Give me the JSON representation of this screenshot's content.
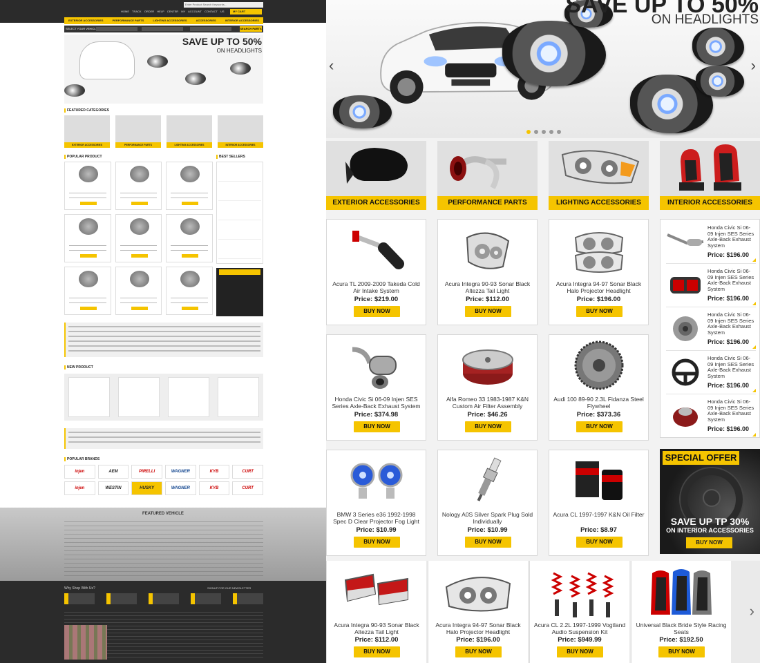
{
  "thumb": {
    "search_placeholder": "Enter Product Search Keywords...",
    "toplinks": "HOME  TRACK ORDER  HELP CENTER  MY ACCOUNT  CONTACT US",
    "cart": "MY CART",
    "nav": [
      "EXTERIOR ACCESSORIES",
      "PERFORMANCE PARTS",
      "LIGHTING ACCESSORIES",
      "ACCESSORIES",
      "INTERIOR ACCESSORIES"
    ],
    "vehicle_label": "SELECT YOUR VEHICLE",
    "search_parts": "SEARCH PARTS",
    "hero_big": "SAVE UP TO 50%",
    "hero_sub": "ON HEADLIGHTS",
    "featured_categories": "FEATURED CATEGORIES",
    "popular_product": "POPULAR PRODUCT",
    "best_sellers": "BEST SELLERS",
    "new_product": "NEW PRODUCT",
    "popular_brands": "POPULAR BRANDS",
    "brands": [
      "injen",
      "AEM",
      "PIRELLI",
      "WAGNER",
      "KYB",
      "CURT",
      "injen",
      "WESTIN",
      "HUSKY",
      "WAGNER",
      "KYB",
      "CURT"
    ],
    "featured_vehicle": "FEATURED VEHICLE",
    "why_shop": "Why Shop With Us?",
    "newsletter": "SIGNUP FOR OUR NEWSLETTER"
  },
  "hero": {
    "title": "SAVE UP TO 50%",
    "subtitle": "ON HEADLIGHTS",
    "dots": 5,
    "active_dot": 0
  },
  "categories": [
    {
      "label": "EXTERIOR ACCESSORIES",
      "icon": "mirror-icon"
    },
    {
      "label": "PERFORMANCE PARTS",
      "icon": "intake-icon"
    },
    {
      "label": "LIGHTING ACCESSORIES",
      "icon": "headlight-icon"
    },
    {
      "label": "INTERIOR ACCESSORIES",
      "icon": "seat-icon"
    }
  ],
  "products": [
    {
      "name": "Acura TL 2009-2009 Takeda Cold Air Intake System",
      "price": "Price: $219.00",
      "icon": "intake-icon"
    },
    {
      "name": "Acura Integra 90-93 Sonar Black Altezza Tail Light",
      "price": "Price: $112.00",
      "icon": "taillight-icon"
    },
    {
      "name": "Acura Integra 94-97 Sonar Black Halo Projector Headlight",
      "price": "Price: $196.00",
      "icon": "headlight-icon"
    },
    {
      "name": "Honda Civic Si 06-09 Injen SES Series Axle-Back Exhaust System",
      "price": "Price: $374.98",
      "icon": "exhaust-icon"
    },
    {
      "name": "Alfa Romeo 33 1983-1987 K&N Custom Air Filter Assembly",
      "price": "Price: $46.26",
      "icon": "air-filter-icon"
    },
    {
      "name": "Audi 100 89-90 2.3L Fidanza Steel Flywheel",
      "price": "Price: $373.36",
      "icon": "flywheel-icon"
    },
    {
      "name": "BMW 3 Series e36 1992-1998 Spec D Clear Projector Fog Light",
      "price": "Price: $10.99",
      "icon": "fog-light-icon"
    },
    {
      "name": "Nology A0S Silver Spark Plug Sold Individually",
      "price": "Price: $10.99",
      "icon": "spark-plug-icon"
    },
    {
      "name": "Acura CL 1997-1997 K&N Oil Filter",
      "price": "Price: $8.97",
      "icon": "oil-filter-icon"
    }
  ],
  "buy_label": "BUY NOW",
  "best_sellers": [
    {
      "name": "Honda Civic Si 06-09 Injen SES Series Axle-Back Exhaust System",
      "price": "Price: $196.00",
      "icon": "exhaust-icon"
    },
    {
      "name": "Honda Civic Si 06-09 Injen SES Series Axle-Back Exhaust System",
      "price": "Price: $196.00",
      "icon": "taillight-icon"
    },
    {
      "name": "Honda Civic Si 06-09 Injen SES Series Axle-Back Exhaust System",
      "price": "Price: $196.00",
      "icon": "clutch-icon"
    },
    {
      "name": "Honda Civic Si 06-09 Injen SES Series Axle-Back Exhaust System",
      "price": "Price: $196.00",
      "icon": "steering-wheel-icon"
    },
    {
      "name": "Honda Civic Si 06-09 Injen SES Series Axle-Back Exhaust System",
      "price": "Price: $196.00",
      "icon": "air-filter-icon"
    }
  ],
  "special": {
    "tag": "SPECIAL OFFER",
    "line1": "SAVE UP TP 30%",
    "line2": "ON INTERIOR ACCESSORIES",
    "button": "BUY NOW"
  },
  "new_products": [
    {
      "name": "Acura Integra 90-93 Sonar Black Altezza Tail Light",
      "price": "Price: $112.00",
      "icon": "taillight-icon"
    },
    {
      "name": "Acura Integra 94-97 Sonar Black Halo Projector Headlight",
      "price": "Price: $196.00",
      "icon": "headlight-icon"
    },
    {
      "name": "Acura CL 2.2L 1997-1999 Vogtland Audio Suspension Kit",
      "price": "Price: $949.99",
      "icon": "coilover-icon"
    },
    {
      "name": "Universal Black Bride Style Racing Seats",
      "price": "Price: $192.50",
      "icon": "racing-seat-icon"
    }
  ],
  "colors": {
    "accent": "#f5c400",
    "dark": "#2b2b2b"
  }
}
